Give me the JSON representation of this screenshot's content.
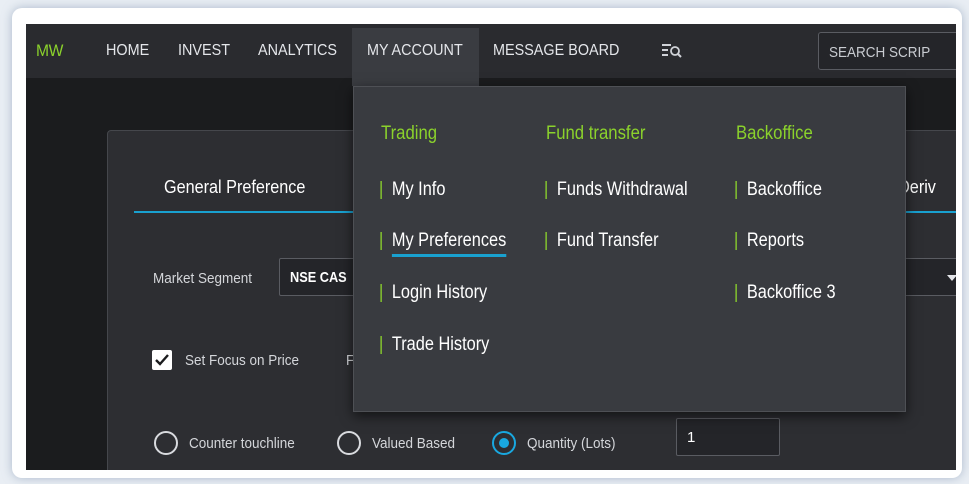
{
  "nav": {
    "logo": "MW",
    "items": [
      "HOME",
      "INVEST",
      "ANALYTICS",
      "MY ACCOUNT",
      "MESSAGE BOARD"
    ],
    "search_placeholder": "SEARCH SCRIP"
  },
  "preferences": {
    "tab_general": "General Preference",
    "tab_right_partial": "in/Deriv",
    "market_segment_label": "Market Segment",
    "market_segment_value": "NSE CAS",
    "set_focus_label": "Set Focus on Price",
    "set_focus_checked": true,
    "partial_label": "F",
    "radio_options": [
      "Counter touchline",
      "Valued Based",
      "Quantity (Lots)"
    ],
    "radio_selected": "Quantity (Lots)",
    "quantity_value": "1"
  },
  "dropdown": {
    "columns": [
      {
        "heading": "Trading",
        "items": [
          "My Info",
          "My Preferences",
          "Login History",
          "Trade History"
        ]
      },
      {
        "heading": "Fund transfer",
        "items": [
          "Funds Withdrawal",
          "Fund Transfer"
        ]
      },
      {
        "heading": "Backoffice",
        "items": [
          "Backoffice",
          "Reports",
          "Backoffice 3"
        ]
      }
    ],
    "active_item": "My Preferences",
    "separator": "|"
  },
  "colors": {
    "accent_green": "#8bd22c",
    "accent_blue": "#19a1d0",
    "background": "#1b1c1e"
  },
  "icons": [
    "list-search-icon",
    "caret-down-icon",
    "checkmark-icon"
  ]
}
